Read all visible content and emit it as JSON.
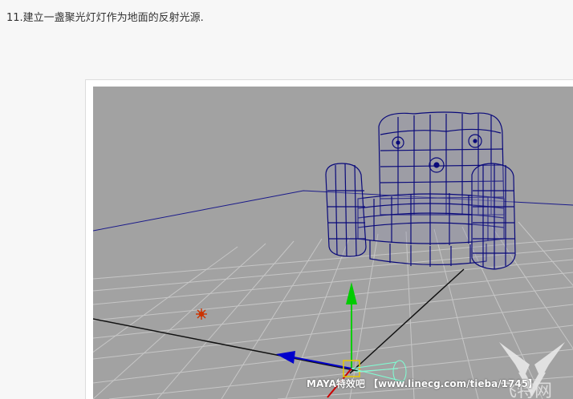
{
  "article": {
    "step_text": "11.建立一盏聚光灯灯作为地面的反射光源."
  },
  "viewport": {
    "background_color": "#a2a2a2",
    "grid_color": "#c8c8c8",
    "wireframe_color": "#0a0a7a",
    "axis_y_color": "#00cc00",
    "axis_z_color": "#0000cc",
    "axis_x_color": "#cc0000",
    "point_light_color": "#cc3300",
    "spotlight_icon": "spotlight-cone-icon",
    "point_light_icon": "point-light-icon",
    "move_manipulator_icon": "move-manipulator-icon"
  },
  "watermark": {
    "text": "MAYA特效吧 【www.linecg.com/tieba/1745】",
    "logo_text": "飞特网"
  }
}
